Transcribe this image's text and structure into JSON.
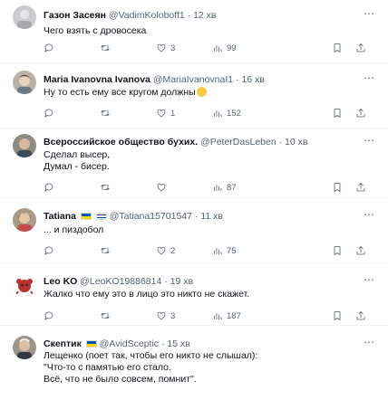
{
  "tweets": [
    {
      "name": "Газон Засеян",
      "handle": "@VadimKoloboff1",
      "time": "12 хв",
      "text": "Чего взять с дровосека",
      "replies": "",
      "retweets": "",
      "likes": "3",
      "views": "99",
      "avatar": "avatar-photo-gray"
    },
    {
      "name": "Maria Ivanovna Ivanova",
      "handle": "@MariaIvanovnaI1",
      "time": "16 хв",
      "text": "Ну то есть ему все кругом должны",
      "replies": "",
      "retweets": "",
      "likes": "1",
      "views": "152",
      "avatar": "avatar-photo-woman"
    },
    {
      "name": "Всероссийское общество бухих.",
      "handle": "@PeterDasLeben",
      "time": "10 хв",
      "text": "Сделал высер,\nДумал - бисер.",
      "replies": "",
      "retweets": "",
      "likes": "",
      "views": "87",
      "avatar": "avatar-photo-man"
    },
    {
      "name": "Tatiana",
      "handle": "@Tatiana15701547",
      "time": "11 хв",
      "text": "... и пиздобол",
      "replies": "",
      "retweets": "",
      "likes": "2",
      "views": "75",
      "avatar": "avatar-photo-woman-2"
    },
    {
      "name": "Leo KO",
      "handle": "@LeoKO19886814",
      "time": "19 хв",
      "text": "Жалко что ему это в лицо это никто не скажет.",
      "replies": "",
      "retweets": "",
      "likes": "3",
      "views": "187",
      "avatar": "avatar-red-creature"
    },
    {
      "name": "Скептик",
      "handle": "@AvidSceptic",
      "time": "15 хв",
      "text": "Лещенко (поет так, чтобы его никто не слышал):\n\"Что-то с памятью его стало.\nВсё, что не было совсем, помнит\".",
      "replies": "",
      "retweets": "",
      "likes": "",
      "views": "",
      "avatar": "avatar-photo-man-2"
    }
  ],
  "separator_dot": "·",
  "more_glyph": "⋯",
  "colors": {
    "text_primary": "#0f1419",
    "text_secondary": "#536471",
    "divider": "#eff3f4",
    "flag_blue": "#0057b7",
    "flag_yellow": "#ffd700"
  }
}
